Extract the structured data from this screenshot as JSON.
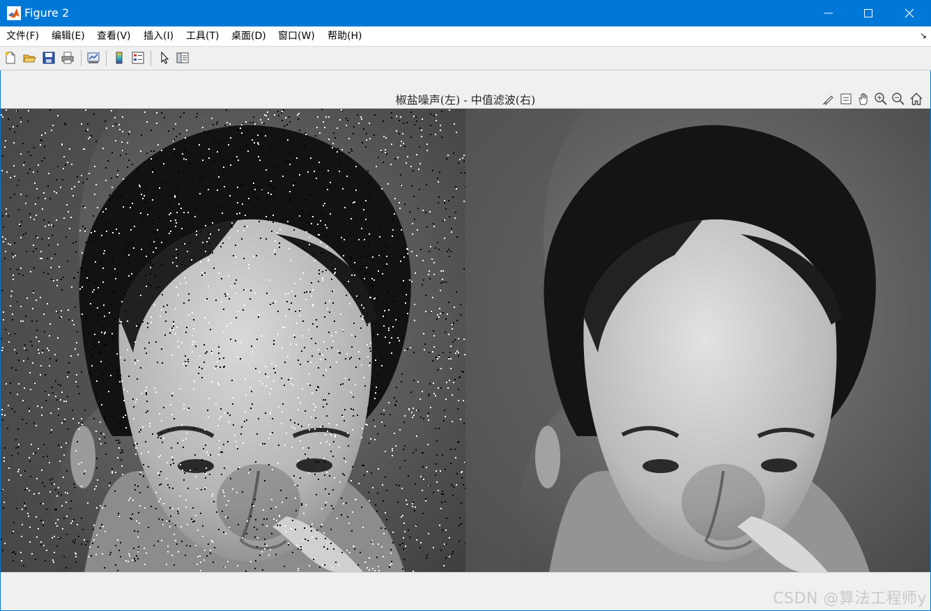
{
  "window": {
    "title": "Figure 2"
  },
  "menu": [
    "文件(F)",
    "编辑(E)",
    "查看(V)",
    "插入(I)",
    "工具(T)",
    "桌面(D)",
    "窗口(W)",
    "帮助(H)"
  ],
  "menu_arrow": "↘",
  "toolbar": [
    "new-figure-icon",
    "open-file-icon",
    "save-icon",
    "print-icon",
    "link-plot-icon",
    "colorbar-icon",
    "legend-icon",
    "select-arrow-icon",
    "property-inspector-icon"
  ],
  "axes_toolbar": [
    "brush-icon",
    "data-tip-icon",
    "pan-hand-icon",
    "zoom-in-icon",
    "zoom-out-icon",
    "home-icon"
  ],
  "figure": {
    "title": "椒盐噪声(左) - 中值滤波(右)"
  },
  "watermark": "CSDN @算法工程师y",
  "colors": {
    "titlebar": "#0078d7",
    "background": "#f0f0f0"
  }
}
